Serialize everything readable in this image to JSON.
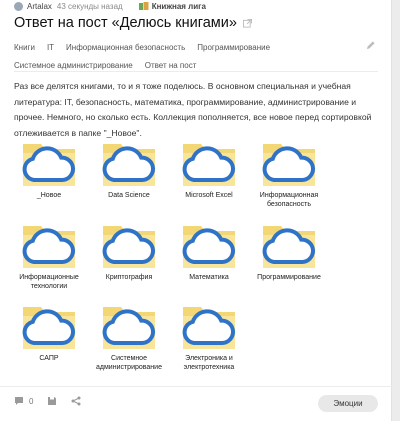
{
  "meta": {
    "author": "Artalax",
    "time": "43 секунды назад",
    "community": "Книжная лига"
  },
  "post": {
    "title": "Ответ на пост «Делюсь книгами»",
    "tags_row1": [
      "Книги",
      "IT",
      "Информационная безопасность",
      "Программирование"
    ],
    "tags_row2": [
      "Системное администрирование",
      "Ответ на пост"
    ],
    "body": "Раз все делятся книгами, то и я тоже поделюсь. В основном специальная и учебная литература: IT, безопасность, математика, программирование, администрирование и прочее. Немного, но сколько есть. Коллекция пополняется, все новое перед сортировкой отлеживается в папке \"_Новое\"."
  },
  "folders": [
    {
      "label": "_Новое"
    },
    {
      "label": "Data Science"
    },
    {
      "label": "Microsoft Excel"
    },
    {
      "label": "Информационная безопасность"
    },
    {
      "label": "Информационные технологии"
    },
    {
      "label": "Криптография"
    },
    {
      "label": "Математика"
    },
    {
      "label": "Программирование"
    },
    {
      "label": "САПР"
    },
    {
      "label": "Системное администрирование"
    },
    {
      "label": "Электроника и электротехника"
    }
  ],
  "footer": {
    "comments_count": "0",
    "emotions_label": "Эмоции"
  },
  "colors": {
    "folder_back": "#f2d774",
    "folder_front": "#f9e59a",
    "cloud": "#2f73c9"
  }
}
